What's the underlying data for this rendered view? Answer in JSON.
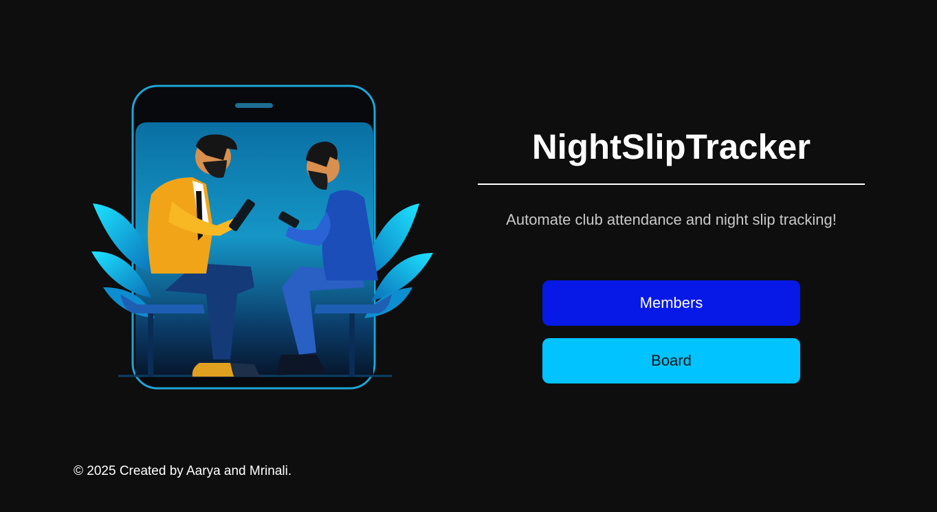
{
  "app": {
    "title": "NightSlipTracker",
    "tagline": "Automate club attendance and night slip tracking!"
  },
  "actions": {
    "members_label": "Members",
    "board_label": "Board"
  },
  "footer": {
    "text": "© 2025 Created by Aarya and Mrinali."
  },
  "illustration": {
    "subject": "two-people-with-phones"
  },
  "colors": {
    "background": "#0e0e0e",
    "members_button": "#0619e6",
    "board_button": "#00c3ff",
    "title": "#ffffff",
    "tagline": "#c9c9c9"
  }
}
